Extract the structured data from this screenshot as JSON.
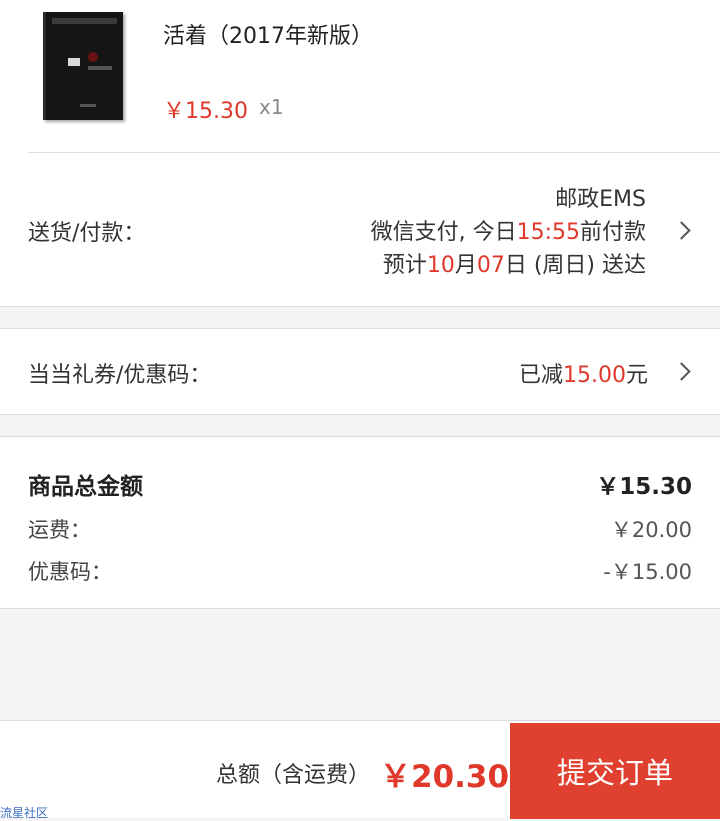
{
  "product": {
    "title": "活着（2017年新版）",
    "price": "￥15.30",
    "quantity": "x1"
  },
  "delivery": {
    "label": "送货/付款：",
    "carrier": "邮政EMS",
    "payment_prefix": "微信支付, 今日",
    "payment_time": "15:55",
    "payment_suffix": "前付款",
    "eta_prefix": "预计",
    "eta_month": "10",
    "eta_month_unit": "月",
    "eta_day": "07",
    "eta_suffix": "日 (周日) 送达"
  },
  "coupon": {
    "label": "当当礼券/优惠码：",
    "value_prefix": "已减",
    "value_amount": "15.00",
    "value_suffix": "元"
  },
  "summary": {
    "total_label": "商品总金额",
    "total_value": "￥15.30",
    "shipping_label": "运费：",
    "shipping_value": "￥20.00",
    "discount_label": "优惠码：",
    "discount_value": "-￥15.00"
  },
  "footer": {
    "total_label": "总额（含运费）",
    "total_amount": "￥20.30",
    "submit_label": "提交订单"
  },
  "watermark": "流星社区",
  "colors": {
    "accent": "#e0382b",
    "button": "#e04030",
    "background": "#f4f4f7"
  }
}
